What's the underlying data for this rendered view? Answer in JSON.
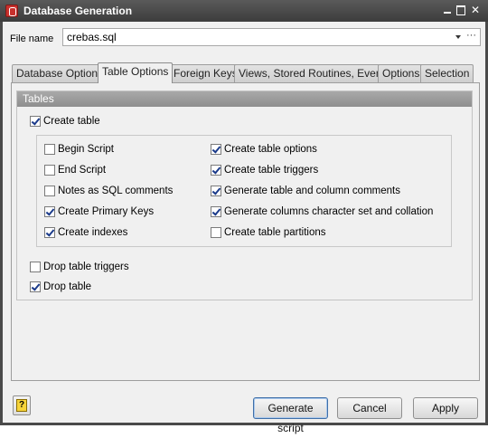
{
  "window": {
    "title": "Database Generation"
  },
  "file": {
    "label": "File name",
    "value": "crebas.sql",
    "browse_label": "···"
  },
  "tabs": [
    {
      "label": "Database Options",
      "active": false
    },
    {
      "label": "Table Options",
      "active": true
    },
    {
      "label": "Foreign Keys",
      "active": false
    },
    {
      "label": "Views, Stored Routines, Events",
      "active": false
    },
    {
      "label": "Options",
      "active": false
    },
    {
      "label": "Selection",
      "active": false
    }
  ],
  "group": {
    "title": "Tables",
    "create_table": {
      "label": "Create table",
      "checked": true
    },
    "left_options": [
      {
        "label": "Begin Script",
        "checked": false
      },
      {
        "label": "End Script",
        "checked": false
      },
      {
        "label": "Notes as SQL comments",
        "checked": false
      },
      {
        "label": "Create Primary Keys",
        "checked": true
      },
      {
        "label": "Create indexes",
        "checked": true
      }
    ],
    "right_options": [
      {
        "label": "Create table options",
        "checked": true
      },
      {
        "label": "Create table triggers",
        "checked": true
      },
      {
        "label": "Generate table and column comments",
        "checked": true
      },
      {
        "label": "Generate columns character set and collation",
        "checked": true
      },
      {
        "label": "Create table partitions",
        "checked": false
      }
    ],
    "drop_triggers": {
      "label": "Drop table triggers",
      "checked": false
    },
    "drop_table": {
      "label": "Drop table",
      "checked": true
    }
  },
  "buttons": {
    "help": "?",
    "generate": "Generate script",
    "cancel": "Cancel",
    "apply": "Apply"
  }
}
